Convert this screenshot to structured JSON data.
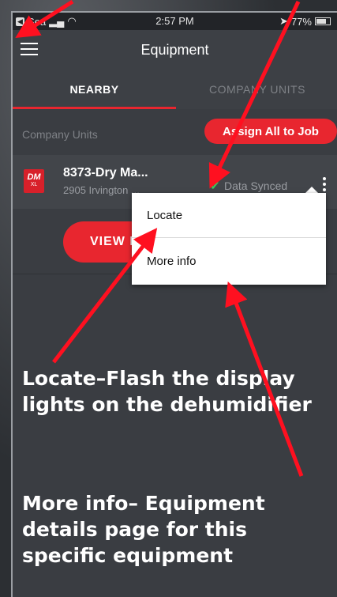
{
  "status_bar": {
    "carrier": "Sea",
    "time": "2:57 PM",
    "battery": "77%"
  },
  "nav": {
    "title": "Equipment"
  },
  "tabs": [
    {
      "label": "NEARBY",
      "active": true
    },
    {
      "label": "COMPANY UNITS",
      "active": false
    }
  ],
  "section": {
    "label": "Company Units",
    "assign_button": "Assign All to Job"
  },
  "equipment_row": {
    "logo_text": "DM",
    "logo_subtext": "XL",
    "name": "8373-Dry Ma...",
    "address": "2905 Irvington ...",
    "status": "Data Synced"
  },
  "view_button": "VIEW E",
  "popup_menu": {
    "items": [
      "Locate",
      "More info"
    ]
  },
  "annotations": {
    "locate": "Locate–Flash the display lights on the dehumidifier",
    "more_info": "More info– Equipment details page for this specific equipment"
  },
  "colors": {
    "accent": "#e8262f",
    "synced": "#3cc65a",
    "arrow": "#ff1020"
  }
}
